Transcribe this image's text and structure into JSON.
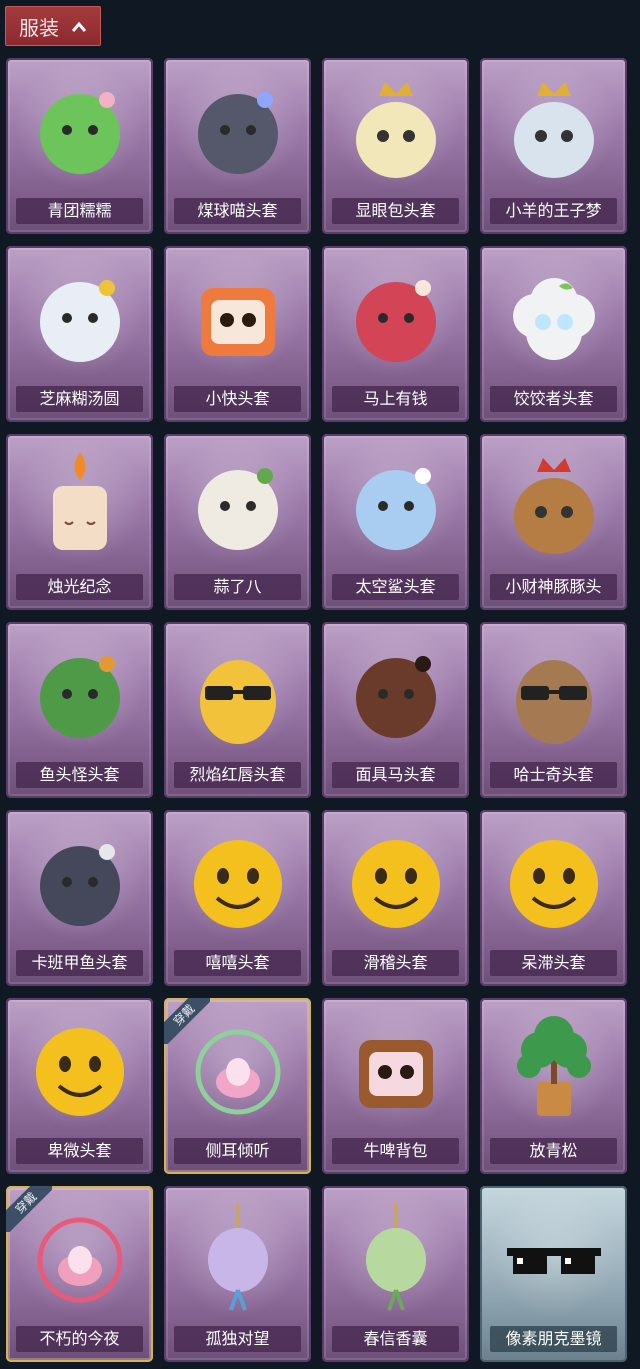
{
  "header": {
    "tab_label": "服装",
    "tab_icon": "chevron-up-icon"
  },
  "colors": {
    "tab": "#9b3236",
    "card_purple": "#9c7aaa",
    "card_silver": "#9fb4bf",
    "equipped_border": "#d2b35b",
    "background": "#101824"
  },
  "items": [
    {
      "name": "青团糯糯",
      "icon": "green-rice-ball-icon",
      "art": "blob",
      "color": "#6cc45a",
      "accent": "#f3b1c6"
    },
    {
      "name": "煤球喵头套",
      "icon": "gray-cat-head-icon",
      "art": "cat",
      "color": "#54586a",
      "accent": "#8fa6ff"
    },
    {
      "name": "显眼包头套",
      "icon": "crowned-bulb-icon",
      "art": "crown",
      "color": "#f1e7b8",
      "accent": "#e0b035"
    },
    {
      "name": "小羊的王子梦",
      "icon": "crowned-sheep-icon",
      "art": "crown",
      "color": "#d8e3ee",
      "accent": "#e0b035"
    },
    {
      "name": "芝麻糊汤圆",
      "icon": "rice-dumpling-icon",
      "art": "blob",
      "color": "#e9eef6",
      "accent": "#f0c23a"
    },
    {
      "name": "小快头套",
      "icon": "orange-tv-head-icon",
      "art": "box",
      "color": "#ef7a3e",
      "accent": "#f6e7da"
    },
    {
      "name": "马上有钱",
      "icon": "red-horse-head-icon",
      "art": "blob",
      "color": "#d24456",
      "accent": "#f6e7da"
    },
    {
      "name": "饺饺者头套",
      "icon": "dumpling-head-icon",
      "art": "cloud",
      "color": "#f1f2f3",
      "accent": "#7dc35a"
    },
    {
      "name": "烛光纪念",
      "icon": "candle-icon",
      "art": "candle",
      "color": "#f4ddc6",
      "accent": "#f08a24"
    },
    {
      "name": "蒜了八",
      "icon": "garlic-icon",
      "art": "blob",
      "color": "#f0ebe2",
      "accent": "#63a84a"
    },
    {
      "name": "太空鲨头套",
      "icon": "shark-head-icon",
      "art": "blob",
      "color": "#a9cdf0",
      "accent": "#ffffff"
    },
    {
      "name": "小财神豚豚头",
      "icon": "capybara-head-icon",
      "art": "crown",
      "color": "#b57d43",
      "accent": "#d23b2f"
    },
    {
      "name": "鱼头怪头套",
      "icon": "fish-head-icon",
      "art": "blob",
      "color": "#4e9a46",
      "accent": "#e09a35"
    },
    {
      "name": "烈焰红唇头套",
      "icon": "pikachu-sunglasses-icon",
      "art": "shades",
      "color": "#f1c23a",
      "accent": "#222222"
    },
    {
      "name": "面具马头套",
      "icon": "horse-mask-icon",
      "art": "blob",
      "color": "#6a3a2a",
      "accent": "#2a1812"
    },
    {
      "name": "哈士奇头套",
      "icon": "husky-sunglasses-icon",
      "art": "shades",
      "color": "#a57a52",
      "accent": "#222222"
    },
    {
      "name": "卡班甲鱼头套",
      "icon": "whale-head-icon",
      "art": "blob",
      "color": "#44485a",
      "accent": "#e6e7ea"
    },
    {
      "name": "嘻嘻头套",
      "icon": "grin-emoji-icon",
      "art": "emoji",
      "color": "#f4c01e",
      "accent": "#3a2a18"
    },
    {
      "name": "滑稽头套",
      "icon": "smirk-emoji-icon",
      "art": "emoji",
      "color": "#f4c01e",
      "accent": "#3a2a18"
    },
    {
      "name": "呆滞头套",
      "icon": "stare-emoji-icon",
      "art": "emoji",
      "color": "#f4c01e",
      "accent": "#3a2a18"
    },
    {
      "name": "卑微头套",
      "icon": "shy-emoji-icon",
      "art": "emoji",
      "color": "#f4c01e",
      "accent": "#3a2a18"
    },
    {
      "name": "侧耳倾听",
      "icon": "lotus-wreath-icon",
      "art": "wreath",
      "color": "#f1a6c9",
      "accent": "#8fcf9a",
      "badge": "穿戴"
    },
    {
      "name": "牛啤背包",
      "icon": "cow-beer-mug-icon",
      "art": "box",
      "color": "#9a5a2e",
      "accent": "#f6d9e0"
    },
    {
      "name": "放青松",
      "icon": "bonsai-pine-icon",
      "art": "tree",
      "color": "#3d9a4c",
      "accent": "#c98a45"
    },
    {
      "name": "不朽的今夜",
      "icon": "pink-fox-bowl-icon",
      "art": "wreath",
      "color": "#f0a0bd",
      "accent": "#e85a7a",
      "badge": "穿戴"
    },
    {
      "name": "孤独对望",
      "icon": "doll-charm-icon",
      "art": "charm",
      "color": "#c9b6e8",
      "accent": "#5aa0d8"
    },
    {
      "name": "春信香囊",
      "icon": "sachet-icon",
      "art": "charm",
      "color": "#b7d9a0",
      "accent": "#6aa85a"
    },
    {
      "name": "像素朋克墨镜",
      "icon": "pixel-sunglasses-icon",
      "art": "pixel",
      "color": "#111111",
      "accent": "#ffffff",
      "rarity": "silver"
    }
  ]
}
